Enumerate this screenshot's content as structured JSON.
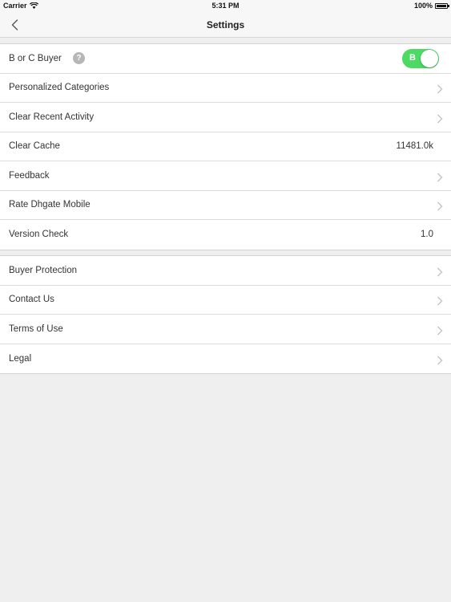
{
  "status_bar": {
    "carrier": "Carrier",
    "time": "5:31 PM",
    "battery": "100%"
  },
  "nav": {
    "title": "Settings",
    "back_icon": "chevron-left-icon"
  },
  "group1": {
    "buyer_type": {
      "label": "B or C Buyer",
      "help": "?",
      "toggle_label": "B",
      "toggle_on": true
    },
    "personalized_categories": {
      "label": "Personalized Categories"
    },
    "clear_recent_activity": {
      "label": "Clear Recent Activity"
    },
    "clear_cache": {
      "label": "Clear Cache",
      "value": "11481.0k"
    },
    "feedback": {
      "label": "Feedback"
    },
    "rate_app": {
      "label": "Rate Dhgate Mobile"
    },
    "version_check": {
      "label": "Version Check",
      "value": "1.0"
    }
  },
  "group2": {
    "buyer_protection": {
      "label": "Buyer Protection"
    },
    "contact_us": {
      "label": "Contact Us"
    },
    "terms_of_use": {
      "label": "Terms of Use"
    },
    "legal": {
      "label": "Legal"
    }
  },
  "colors": {
    "toggle_on": "#4cd964",
    "background": "#efefef",
    "chevron": "#c7c7cc"
  }
}
